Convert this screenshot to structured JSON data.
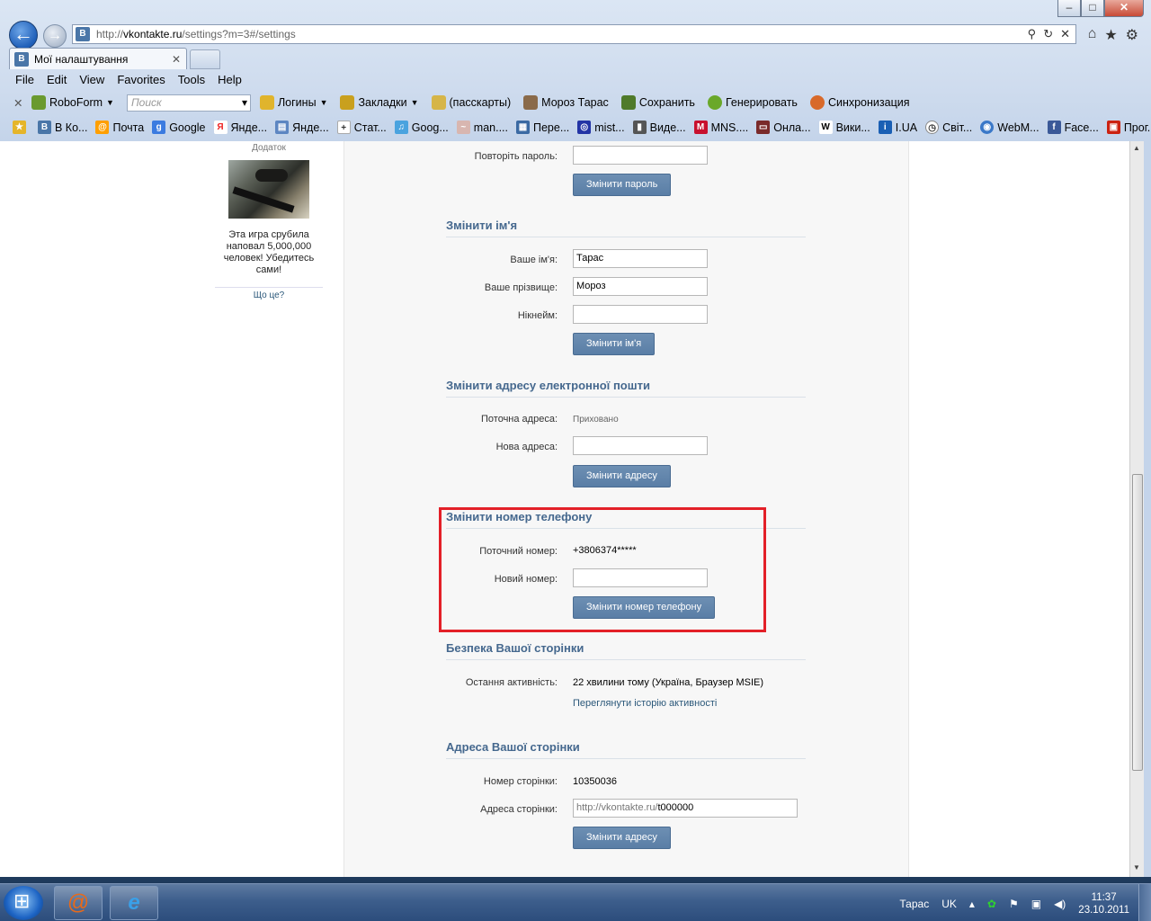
{
  "browser": {
    "url_prefix": "http://",
    "url_domain": "vkontakte.ru",
    "url_path": "/settings?m=3#/settings",
    "tab_title": "Мої налаштування",
    "menu": [
      "File",
      "Edit",
      "View",
      "Favorites",
      "Tools",
      "Help"
    ],
    "roboform": {
      "label": "RoboForm",
      "search_placeholder": "Поиск",
      "items": [
        "Логины",
        "Закладки",
        "(пасскарты)",
        "Мороз Тарас",
        "Сохранить",
        "Генерировать",
        "Синхронизация"
      ]
    },
    "favorites": [
      "В Ко...",
      "Почта",
      "Google",
      "Янде...",
      "Янде...",
      "Стат...",
      "Goog...",
      "man....",
      "Пере...",
      "mist...",
      "Виде...",
      "MNS....",
      "Онла...",
      "Вики...",
      "I.UA",
      "Світ...",
      "WebM...",
      "Face...",
      "Прог..."
    ]
  },
  "sidebar": {
    "ad_header": "Додаток",
    "ad_text": "Эта игра срубила наповал 5,000,000 человек! Убедитесь сами!",
    "ad_link": "Що це?"
  },
  "settings": {
    "repeat_password_label": "Повторіть пароль:",
    "change_password_button": "Змінити пароль",
    "name_section": {
      "title": "Змінити ім'я",
      "first_name_label": "Ваше ім'я:",
      "first_name_value": "Тарас",
      "last_name_label": "Ваше прізвище:",
      "last_name_value": "Мороз",
      "nickname_label": "Нікнейм:",
      "button": "Змінити ім'я"
    },
    "email_section": {
      "title": "Змінити адресу електронної пошти",
      "current_label": "Поточна адреса:",
      "current_value": "Приховано",
      "new_label": "Нова адреса:",
      "button": "Змінити адресу"
    },
    "phone_section": {
      "title": "Змінити номер телефону",
      "current_label": "Поточний номер:",
      "current_value": "+3806374*****",
      "new_label": "Новий номер:",
      "button": "Змінити номер телефону"
    },
    "security_section": {
      "title": "Безпека Вашої сторінки",
      "last_activity_label": "Остання активність:",
      "last_activity_value": "22 хвилини тому (Україна, Браузер MSIE)",
      "history_link": "Переглянути історію активності"
    },
    "address_section": {
      "title": "Адреса Вашої сторінки",
      "page_number_label": "Номер сторінки:",
      "page_number_value": "10350036",
      "page_address_label": "Адреса сторінки:",
      "page_address_prefix": "http://vkontakte.ru/",
      "page_address_value": "t000000",
      "button": "Змінити адресу"
    }
  },
  "taskbar": {
    "user": "Тарас",
    "language": "UK",
    "time": "11:37",
    "date": "23.10.2011"
  },
  "colors": {
    "accent": "#45688e",
    "button": "#5a7ea6",
    "highlight": "#e32028",
    "link": "#2b587a"
  }
}
